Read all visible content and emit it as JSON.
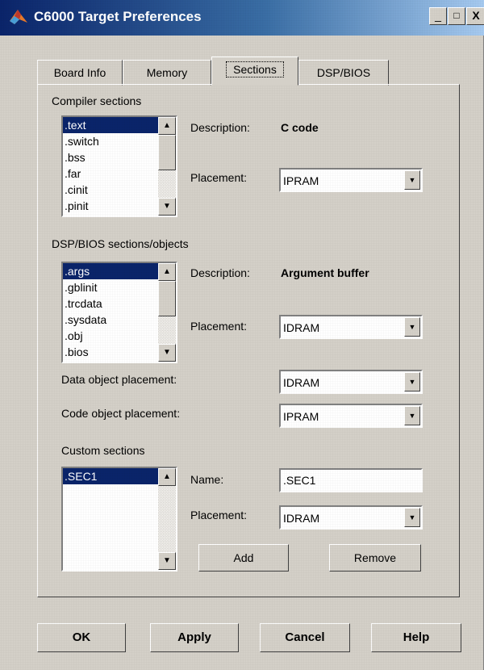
{
  "window": {
    "title": "C6000 Target Preferences"
  },
  "title_buttons": {
    "minimize": "_",
    "maximize": "□",
    "close": "X"
  },
  "tabs": [
    {
      "label": "Board Info"
    },
    {
      "label": "Memory"
    },
    {
      "label": "Sections",
      "active": true
    },
    {
      "label": "DSP/BIOS"
    }
  ],
  "compiler": {
    "heading": "Compiler sections",
    "items": [
      ".text",
      ".switch",
      ".bss",
      ".far",
      ".cinit",
      ".pinit"
    ],
    "selected": ".text",
    "description_label": "Description:",
    "description": "C code",
    "placement_label": "Placement:",
    "placement": "IPRAM"
  },
  "bios": {
    "heading": "DSP/BIOS sections/objects",
    "items": [
      ".args",
      ".gblinit",
      ".trcdata",
      ".sysdata",
      ".obj",
      ".bios"
    ],
    "selected": ".args",
    "description_label": "Description:",
    "description": "Argument buffer",
    "placement_label": "Placement:",
    "placement": "IDRAM"
  },
  "data_object": {
    "label": "Data object placement:",
    "value": "IDRAM"
  },
  "code_object": {
    "label": "Code object placement:",
    "value": "IPRAM"
  },
  "custom": {
    "heading": "Custom sections",
    "items": [
      ".SEC1"
    ],
    "selected": ".SEC1",
    "name_label": "Name:",
    "name": ".SEC1",
    "placement_label": "Placement:",
    "placement": "IDRAM",
    "add": "Add",
    "remove": "Remove"
  },
  "buttons": {
    "ok": "OK",
    "apply": "Apply",
    "cancel": "Cancel",
    "help": "Help"
  },
  "colors": {
    "title_start": "#0a246a",
    "title_end": "#a6caf0",
    "selection": "#0a246a",
    "face": "#d4d0c8"
  }
}
